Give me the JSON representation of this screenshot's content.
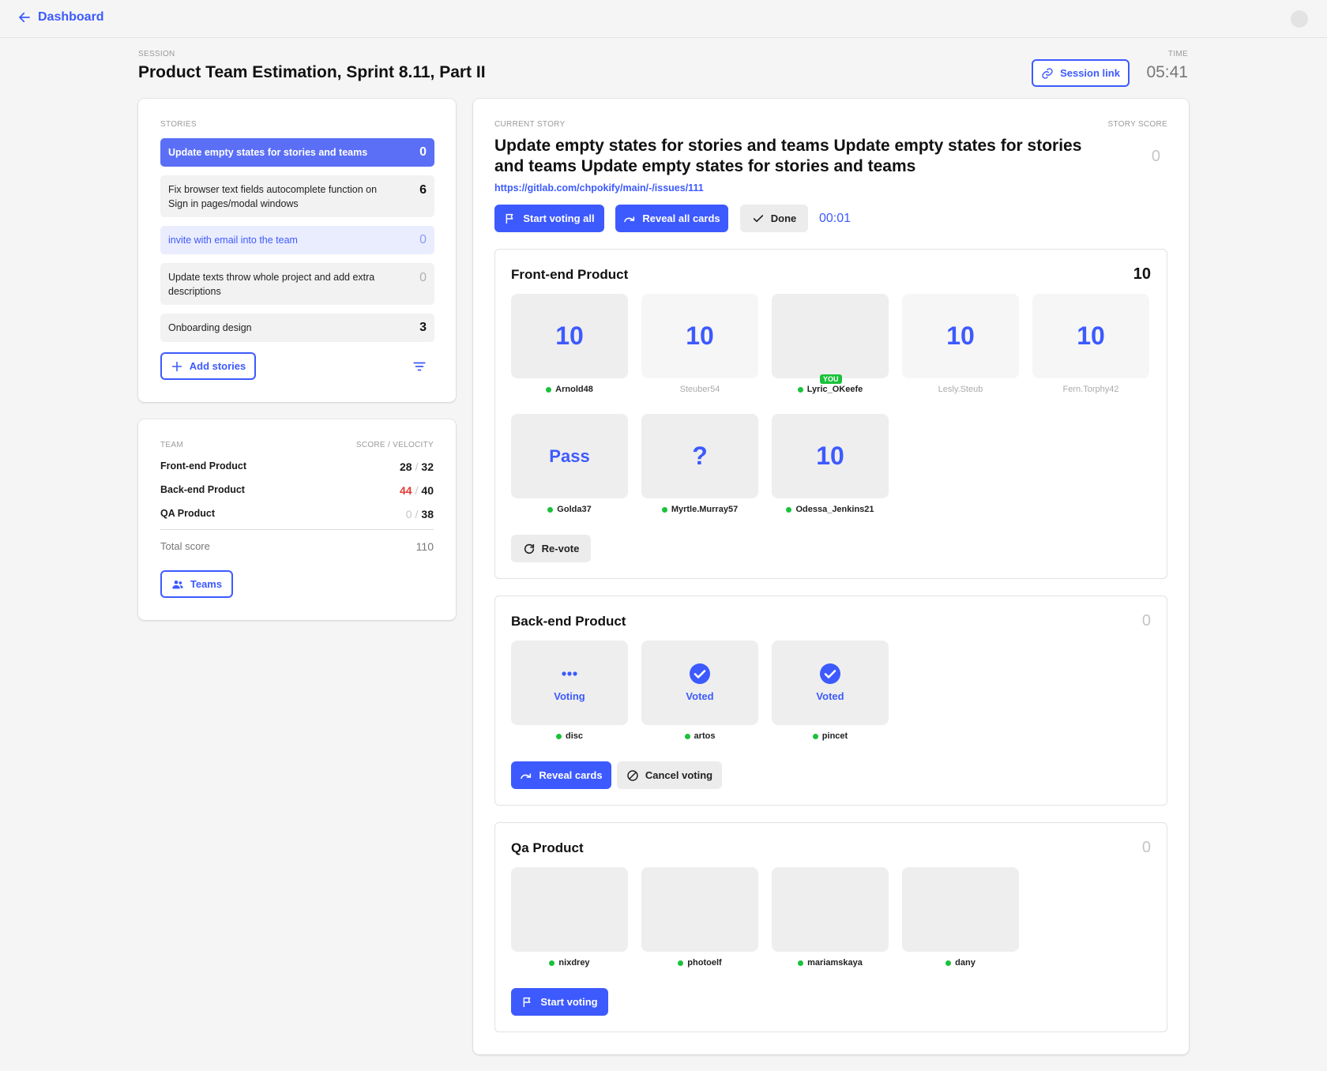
{
  "nav": {
    "back_label": "Dashboard"
  },
  "header": {
    "session_label": "SESSION",
    "session_title": "Product Team Estimation, Sprint 8.11, Part II",
    "time_label": "TIME",
    "time_value": "05:41",
    "session_link_label": "Session link"
  },
  "stories": {
    "label": "STORIES",
    "items": [
      {
        "text": "Update empty states for stories and teams",
        "score": "0"
      },
      {
        "text": "Fix browser text fields autocomplete function on Sign in pages/modal windows",
        "score": "6"
      },
      {
        "text": "invite with email into the team",
        "score": "0"
      },
      {
        "text": "Update texts throw whole project and add extra descriptions",
        "score": "0"
      },
      {
        "text": "Onboarding design",
        "score": "3"
      }
    ],
    "add_label": "Add stories"
  },
  "team": {
    "label": "TEAM",
    "score_label": "SCORE / VELOCITY",
    "rows": [
      {
        "name": "Front-end Product",
        "score": "28",
        "velocity": "32"
      },
      {
        "name": "Back-end Product",
        "score": "44",
        "velocity": "40"
      },
      {
        "name": "QA Product",
        "score": "0",
        "velocity": "38"
      }
    ],
    "sep": "/",
    "total_label": "Total score",
    "total_value": "110",
    "teams_label": "Teams"
  },
  "current": {
    "label": "CURRENT STORY",
    "score_label": "STORY SCORE",
    "title": "Update empty states for stories and teams Update empty states for stories and teams Update empty states for stories and teams",
    "score": "0",
    "link": "https://gitlab.com/chpokify/main/-/issues/111",
    "start_all_label": "Start voting all",
    "reveal_all_label": "Reveal all cards",
    "done_label": "Done",
    "timer": "00:01"
  },
  "groups": {
    "frontend": {
      "title": "Front-end Product",
      "score": "10",
      "cards": [
        {
          "value": "10",
          "voter": "Arnold48"
        },
        {
          "value": "10",
          "voter": "Steuber54"
        },
        {
          "value": "",
          "voter": "Lyric_OKeefe",
          "badge": "YOU"
        },
        {
          "value": "10",
          "voter": "Lesly.Steub"
        },
        {
          "value": "10",
          "voter": "Fern.Torphy42"
        },
        {
          "value": "Pass",
          "voter": "Golda37"
        },
        {
          "value": "?",
          "voter": "Myrtle.Murray57"
        },
        {
          "value": "10",
          "voter": "Odessa_Jenkins21"
        }
      ],
      "revote_label": "Re-vote"
    },
    "backend": {
      "title": "Back-end Product",
      "score": "0",
      "cards": [
        {
          "state": "Voting",
          "voter": "disc"
        },
        {
          "state": "Voted",
          "voter": "artos"
        },
        {
          "state": "Voted",
          "voter": "pincet"
        }
      ],
      "reveal_label": "Reveal cards",
      "cancel_label": "Cancel voting"
    },
    "qa": {
      "title": "Qa Product",
      "score": "0",
      "cards": [
        {
          "voter": "nixdrey"
        },
        {
          "voter": "photoelf"
        },
        {
          "voter": "mariamskaya"
        },
        {
          "voter": "dany"
        }
      ],
      "start_label": "Start voting"
    }
  },
  "colors": {
    "accent": "#3d5afe",
    "online": "#19c23a",
    "danger": "#e53935"
  }
}
